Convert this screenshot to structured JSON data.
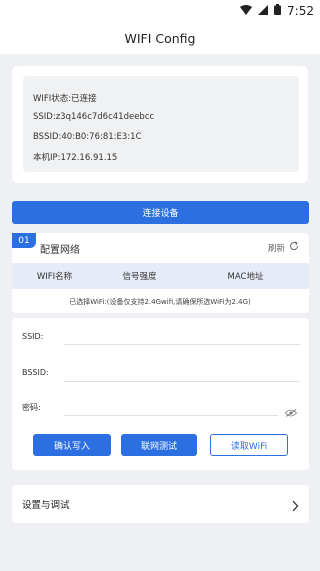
{
  "status_bar": {
    "time": "7:52"
  },
  "header": {
    "title": "WIFI Config"
  },
  "info": {
    "wifi_status": "WIFI状态:已连接",
    "ssid": "SSID:z3q146c7d6c41deebcc",
    "bssid": "BSSID:40:B0:76:81:E3:1C",
    "ip": "本机IP:172.16.91.15"
  },
  "connect_button": "连接设备",
  "wifi_section": {
    "number": "01",
    "title": "配置网络",
    "refresh_label": "刷新",
    "columns": [
      "WIFI名称",
      "信号强度",
      "MAC地址"
    ]
  },
  "selected_note": "已选择WiFi:(设备仅支持2.4Gwifi,请确保所选WiFi为2.4G)",
  "form": {
    "ssid_label": "SSID:",
    "ssid_value": "",
    "bssid_label": "BSSID:",
    "bssid_value": "",
    "password_label": "密码:",
    "password_value": "",
    "buttons": {
      "confirm": "确认写入",
      "test": "联网测试",
      "read": "读取WiFi"
    }
  },
  "settings": {
    "label": "设置与调试"
  },
  "colors": {
    "accent": "#2b6fe0",
    "background": "#eef0f4"
  }
}
